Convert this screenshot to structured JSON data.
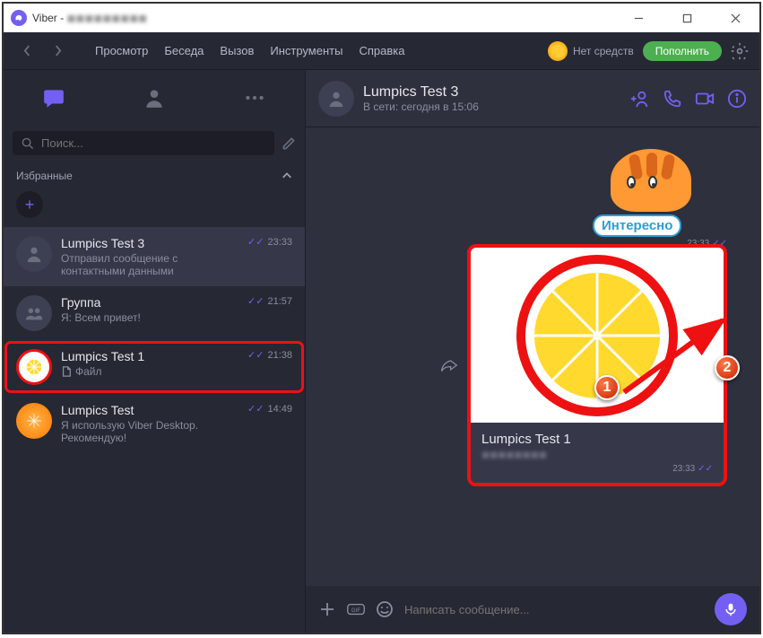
{
  "window": {
    "app": "Viber",
    "title_blur": "◼◼◼◼◼◼◼◼◼"
  },
  "menubar": {
    "items": [
      "Просмотр",
      "Беседа",
      "Вызов",
      "Инструменты",
      "Справка"
    ],
    "balance": "Нет средств",
    "topup": "Пополнить"
  },
  "search": {
    "placeholder": "Поиск..."
  },
  "sections": {
    "favorites": "Избранные"
  },
  "chats": [
    {
      "name": "Lumpics Test 3",
      "preview": "Отправил сообщение с контактными данными",
      "time": "23:33",
      "read": true
    },
    {
      "name": "Группа",
      "preview": "Я: Всем привет!",
      "time": "21:57",
      "read": true
    },
    {
      "name": "Lumpics Test 1",
      "preview": "Файл",
      "time": "21:38",
      "read": true,
      "file_icon": true
    },
    {
      "name": "Lumpics Test",
      "preview": "Я использую Viber Desktop. Рекомендую!",
      "time": "14:49",
      "read": true
    }
  ],
  "conversation": {
    "header": {
      "name": "Lumpics Test 3",
      "status": "В сети: сегодня в 15:06"
    },
    "sticker": {
      "label": "Интересно",
      "time": "23:33"
    },
    "contact_card": {
      "name": "Lumpics Test 1",
      "sub": "◼◼◼◼◼◼◼◼",
      "time": "23:33"
    }
  },
  "composer": {
    "placeholder": "Написать сообщение..."
  },
  "callouts": [
    "1",
    "2"
  ],
  "colors": {
    "accent": "#7360f2",
    "highlight": "#e11",
    "green": "#4caf50"
  }
}
